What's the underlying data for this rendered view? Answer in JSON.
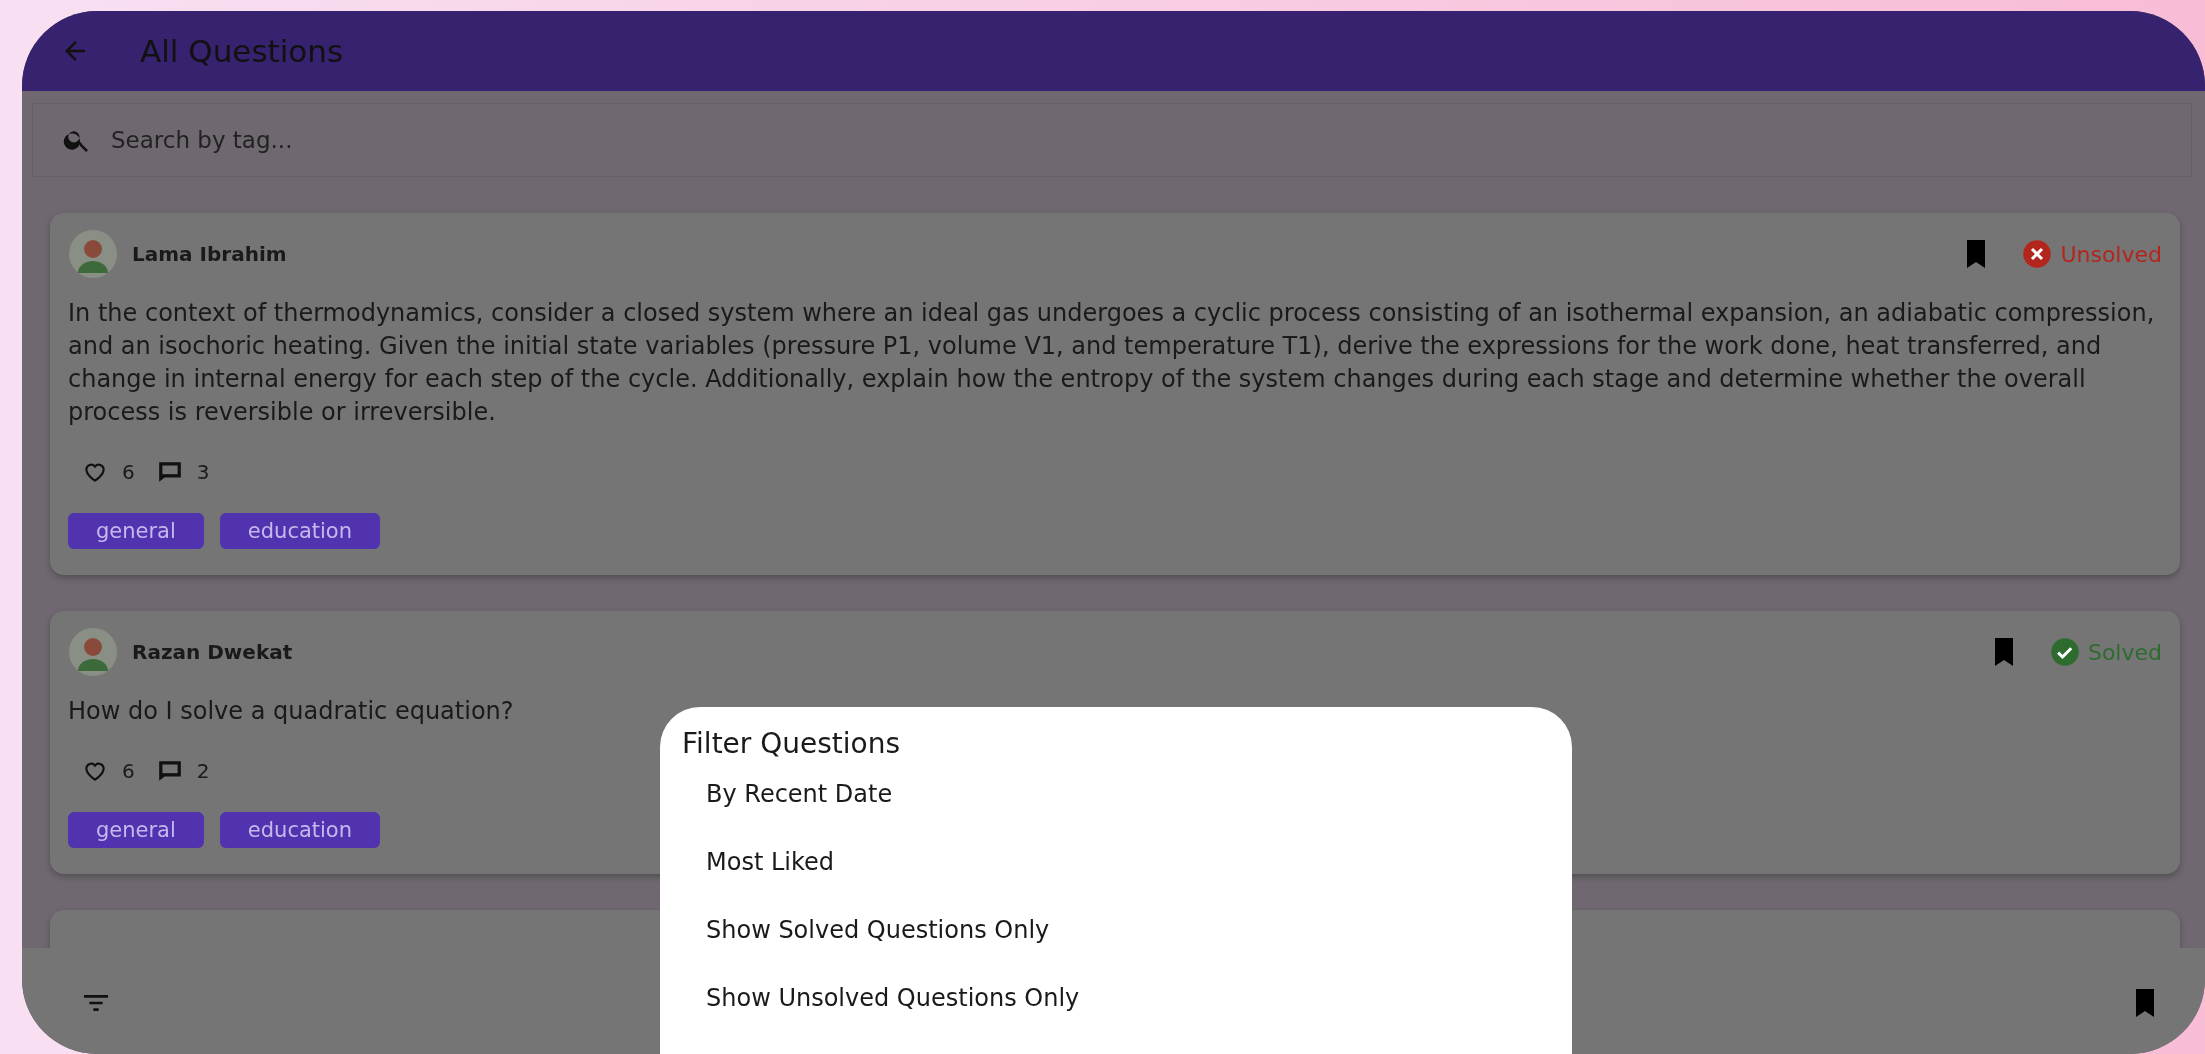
{
  "app_bar": {
    "title": "All Questions"
  },
  "search": {
    "placeholder": "Search by tag..."
  },
  "questions": [
    {
      "author": "Lama Ibrahim",
      "solved": false,
      "status_label": "Unsolved",
      "text": "In the context of thermodynamics, consider a closed system where an ideal gas undergoes a cyclic process consisting of an isothermal expansion, an adiabatic compression, and an isochoric heating. Given the initial state variables (pressure P1, volume V1, and temperature T1), derive the expressions for the work done, heat transferred, and change in internal energy for each step of the cycle. Additionally, explain how the entropy of the system changes during each stage and determine whether the overall process is reversible or irreversible.",
      "liked": false,
      "likes": "6",
      "comments": "3",
      "tags": [
        "general",
        "education"
      ]
    },
    {
      "author": "Razan Dwekat",
      "solved": true,
      "status_label": "Solved",
      "text": "How do I solve a quadratic equation?",
      "liked": false,
      "likes": "6",
      "comments": "2",
      "tags": [
        "general",
        "education"
      ]
    }
  ],
  "filter_dialog": {
    "title": "Filter Questions",
    "options": [
      "By Recent Date",
      "Most Liked",
      "Show Solved Questions Only",
      "Show Unsolved Questions Only"
    ]
  }
}
